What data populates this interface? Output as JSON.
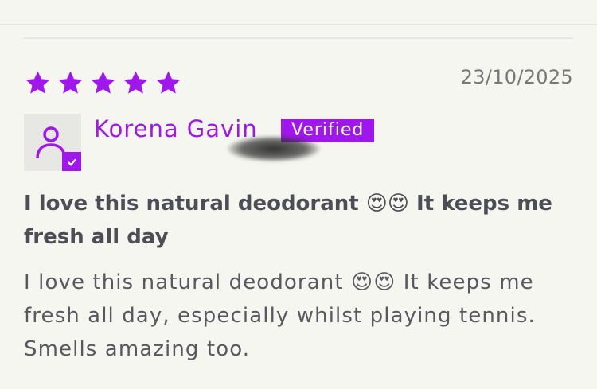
{
  "review": {
    "rating": 5,
    "max_rating": 5,
    "date": "23/10/2025",
    "reviewer_name": "Korena Gavin",
    "verified_label": "Verified",
    "title": "I love this natural deodorant 😍😍 It keeps me fresh all day",
    "body": "I love this natural deodorant 😍😍 It keeps me fresh all day, especially whilst playing tennis. Smells amazing too."
  },
  "icons": {
    "star": "star-icon",
    "avatar": "user-icon",
    "verified": "check-icon"
  },
  "colors": {
    "accent": "#9f17ea",
    "background": "#f5f6f0",
    "text": "#4d4d55",
    "date": "#787878"
  }
}
